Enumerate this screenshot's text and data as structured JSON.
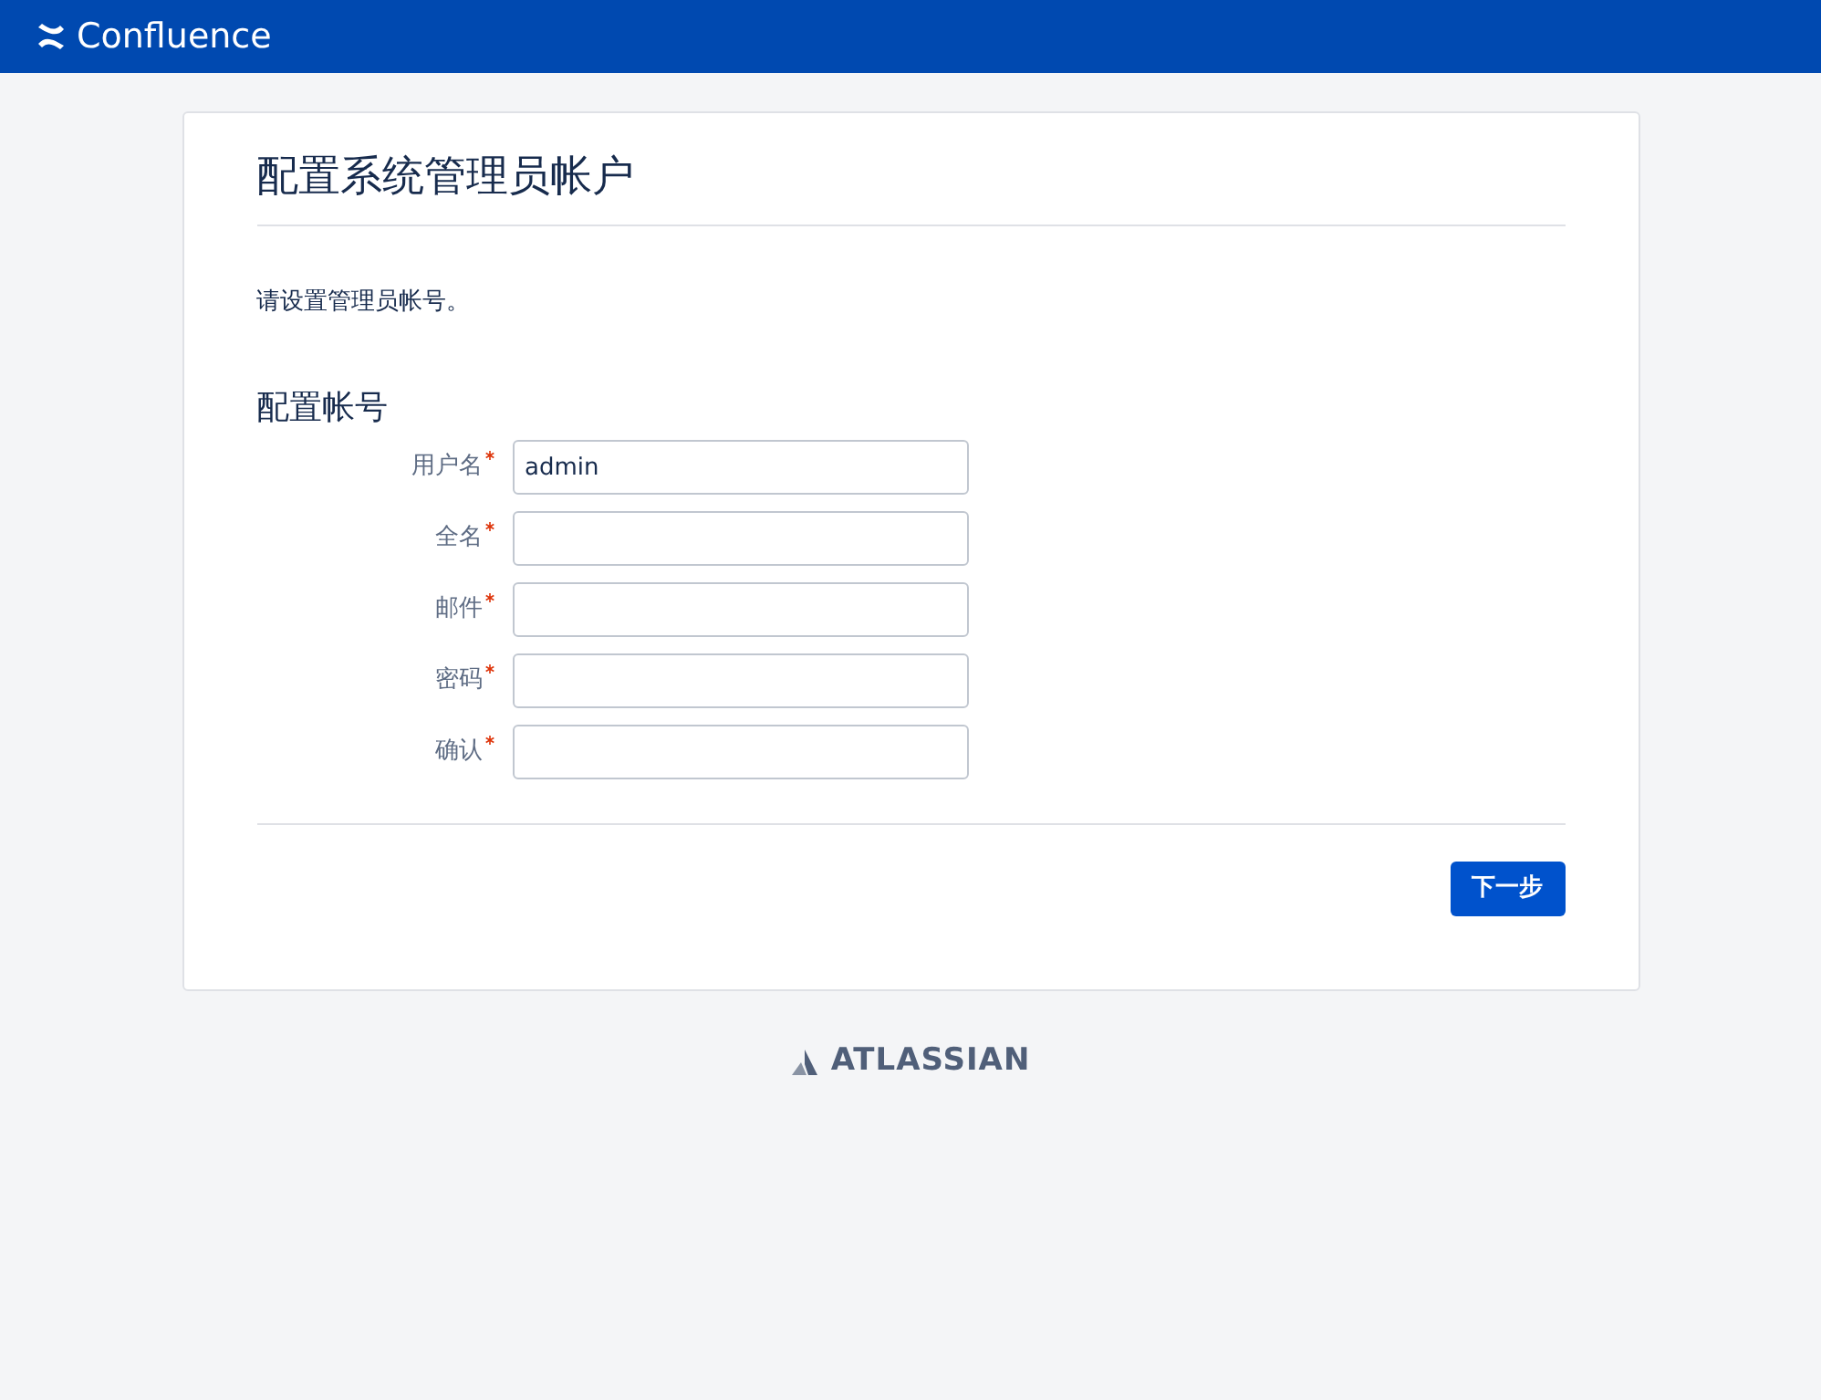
{
  "header": {
    "product": "Confluence"
  },
  "page": {
    "title": "配置系统管理员帐户",
    "intro": "请设置管理员帐号。",
    "section_title": "配置帐号"
  },
  "fields": [
    {
      "label": "用户名",
      "required": true,
      "value": "admin"
    },
    {
      "label": "全名",
      "required": true
    },
    {
      "label": "邮件",
      "required": true
    },
    {
      "label": "密码",
      "required": true
    },
    {
      "label": "确认",
      "required": true
    }
  ],
  "buttons": [
    {
      "label": "下一步"
    }
  ],
  "footer": {
    "brand": "ATLASSIAN"
  }
}
